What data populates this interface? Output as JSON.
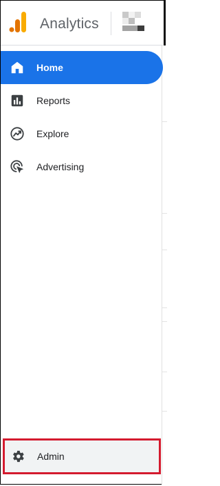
{
  "app": {
    "title": "Analytics"
  },
  "nav": {
    "items": [
      {
        "label": "Home",
        "icon": "home-icon",
        "active": true
      },
      {
        "label": "Reports",
        "icon": "reports-icon",
        "active": false
      },
      {
        "label": "Explore",
        "icon": "explore-icon",
        "active": false
      },
      {
        "label": "Advertising",
        "icon": "advertising-icon",
        "active": false
      }
    ]
  },
  "footer": {
    "admin_label": "Admin",
    "admin_icon": "gear-icon"
  },
  "colors": {
    "accent": "#1a73e8",
    "highlight": "#d41a2e",
    "logo_orange": "#f9ab00",
    "logo_dark": "#e37400"
  }
}
